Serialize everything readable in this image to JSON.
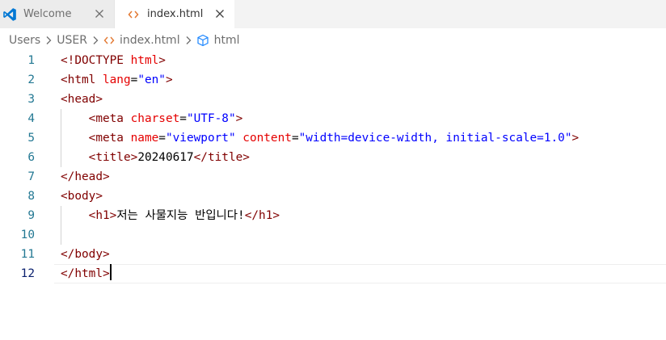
{
  "tabs": [
    {
      "label": "Welcome",
      "icon": "vscode-logo-icon",
      "active": false
    },
    {
      "label": "index.html",
      "icon": "html-file-icon",
      "active": true
    }
  ],
  "breadcrumb": {
    "items": [
      "Users",
      "USER",
      "index.html",
      "html"
    ]
  },
  "editor": {
    "lines": [
      {
        "num": "1",
        "tokens": [
          [
            "tg",
            "<!DOCTYPE "
          ],
          [
            "at",
            "html"
          ],
          [
            "tg",
            ">"
          ]
        ]
      },
      {
        "num": "2",
        "tokens": [
          [
            "tg",
            "<html "
          ],
          [
            "at",
            "lang"
          ],
          [
            "tx",
            "="
          ],
          [
            "st",
            "\"en\""
          ],
          [
            "tg",
            ">"
          ]
        ]
      },
      {
        "num": "3",
        "tokens": [
          [
            "tg",
            "<head>"
          ]
        ]
      },
      {
        "num": "4",
        "tokens": [
          [
            "tx",
            "    "
          ],
          [
            "tg",
            "<meta "
          ],
          [
            "at",
            "charset"
          ],
          [
            "tx",
            "="
          ],
          [
            "st",
            "\"UTF-8\""
          ],
          [
            "tg",
            ">"
          ]
        ]
      },
      {
        "num": "5",
        "tokens": [
          [
            "tx",
            "    "
          ],
          [
            "tg",
            "<meta "
          ],
          [
            "at",
            "name"
          ],
          [
            "tx",
            "="
          ],
          [
            "st",
            "\"viewport\""
          ],
          [
            "tx",
            " "
          ],
          [
            "at",
            "content"
          ],
          [
            "tx",
            "="
          ],
          [
            "st",
            "\"width=device-width, initial-scale=1.0\""
          ],
          [
            "tg",
            ">"
          ]
        ]
      },
      {
        "num": "6",
        "tokens": [
          [
            "tx",
            "    "
          ],
          [
            "tg",
            "<title>"
          ],
          [
            "tx",
            "20240617"
          ],
          [
            "tg",
            "</title>"
          ]
        ]
      },
      {
        "num": "7",
        "tokens": [
          [
            "tg",
            "</head>"
          ]
        ]
      },
      {
        "num": "8",
        "tokens": [
          [
            "tg",
            "<body>"
          ]
        ]
      },
      {
        "num": "9",
        "tokens": [
          [
            "tx",
            "    "
          ],
          [
            "tg",
            "<h1>"
          ],
          [
            "tx",
            "저는 사물지능 반입니다!"
          ],
          [
            "tg",
            "</h1>"
          ]
        ]
      },
      {
        "num": "10",
        "tokens": []
      },
      {
        "num": "11",
        "tokens": [
          [
            "tg",
            "</body>"
          ]
        ]
      },
      {
        "num": "12",
        "tokens": [
          [
            "tg",
            "</html>"
          ]
        ]
      }
    ],
    "active_line": "12"
  },
  "colors": {
    "tag": "#800000",
    "attribute": "#e50000",
    "string": "#0000ff",
    "line_number": "#237893",
    "accent_vscode": "#0078d4",
    "html_icon": "#e37933"
  }
}
